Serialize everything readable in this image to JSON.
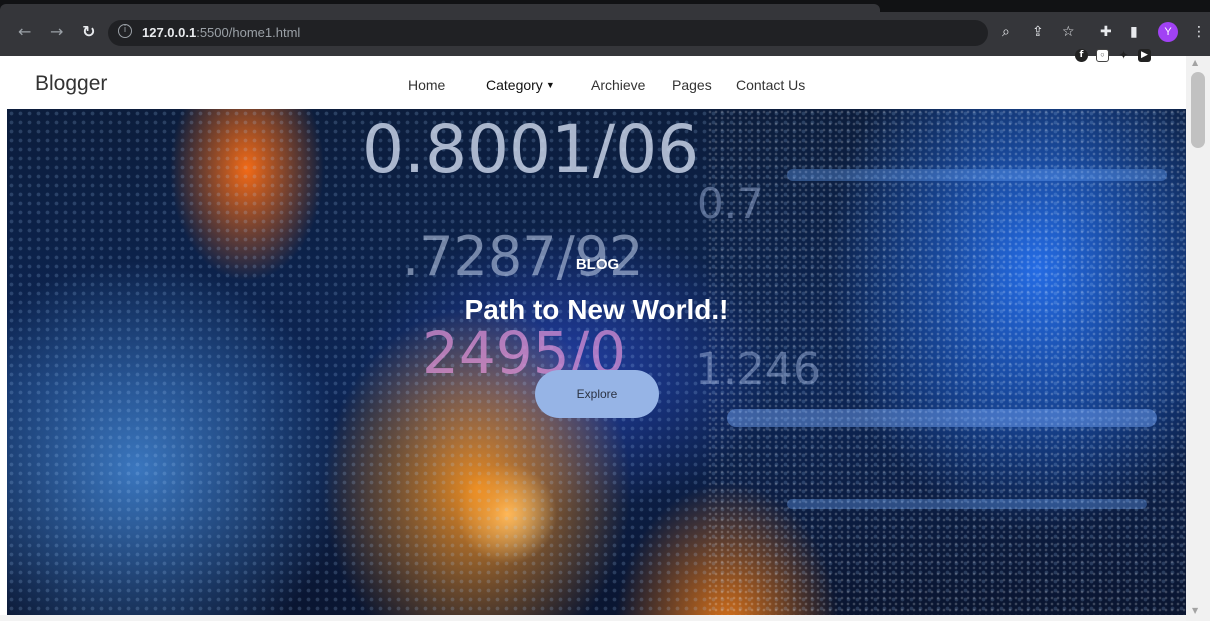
{
  "browser": {
    "url_host": "127.0.0.1",
    "url_path": ":5500/home1.html",
    "profile_initial": "Y",
    "icons": [
      "back-icon",
      "forward-icon",
      "reload-icon",
      "info-icon",
      "zoom-icon",
      "share-icon",
      "star-icon",
      "extensions-icon",
      "side-panel-icon",
      "profile-avatar",
      "menu-icon"
    ]
  },
  "header": {
    "brand": "Blogger",
    "menu": [
      {
        "label": "Home"
      },
      {
        "label": "Category"
      },
      {
        "label": "Archieve"
      },
      {
        "label": "Pages"
      },
      {
        "label": "Contact Us"
      }
    ],
    "socials": [
      "facebook-icon",
      "instagram-icon",
      "twitter-icon",
      "youtube-icon"
    ]
  },
  "hero": {
    "kicker": "BLOG",
    "title": "Path to New World.!",
    "button_label": "Explore",
    "background_numbers": [
      "0.8001/06",
      ".7287/92",
      "2495/0",
      "0.7",
      "1.246"
    ]
  },
  "colors": {
    "button_bg": "#96b4e6",
    "chrome_bg": "#35363a",
    "avatar": "#a142f4"
  }
}
